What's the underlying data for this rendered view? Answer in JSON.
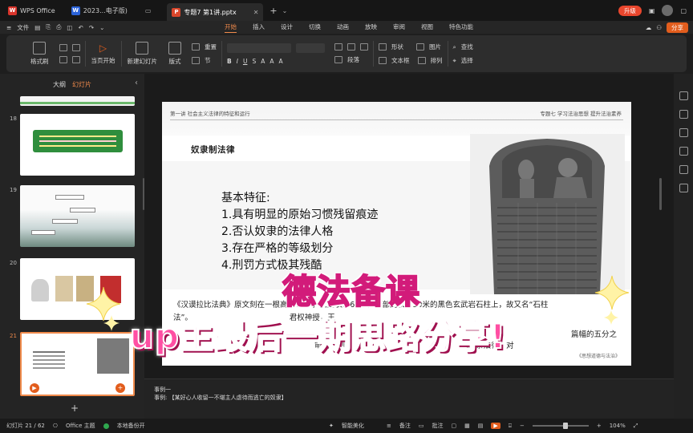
{
  "titlebar": {
    "app_tab": "WPS Office",
    "doc_tab": "2023...电子版)",
    "ppt_tab": "专题7 第1讲.pptx",
    "upgrade": "升级"
  },
  "menubar": {
    "file": "文件",
    "tabs": [
      "开始",
      "插入",
      "设计",
      "切换",
      "动画",
      "放映",
      "审阅",
      "视图",
      "特色功能"
    ],
    "active_tab": "开始",
    "share": "分享"
  },
  "ribbon": {
    "format_painter": "格式刷",
    "play_from_current": "当页开始",
    "new_slide": "新建幻灯片",
    "layout": "版式",
    "section": "节",
    "reset": "重置",
    "paragraph": "段落",
    "shape": "形状",
    "image": "图片",
    "textbox": "文本框",
    "arrange": "排列",
    "find": "查找",
    "select": "选择"
  },
  "sidebar": {
    "tab_outline": "大纲",
    "tab_slides": "幻灯片",
    "slide_numbers": [
      "18",
      "19",
      "20",
      "21"
    ]
  },
  "slide": {
    "header_left": "第一讲  社会主义法律的特征和运行",
    "header_right": "专题七  学习法治思想  提升法治素养",
    "title": "奴隶制法律",
    "features_heading": "基本特征:",
    "features": [
      "1.具有明显的原始习惯残留痕迹",
      "2.否认奴隶的法律人格",
      "3.存在严格的等级划分",
      "4.刑罚方式极其残酷"
    ],
    "para_line1": "《汉谟拉比法典》原文刻在一根高2.25米，上周长1.65米，底部周长1.90米的黑色玄武岩石柱上，故又名“石柱",
    "para_line2": "法”。                                        君权神授，王",
    "para_line3": "篇幅的五分之",
    "para_line4": "审判等制                                                  82条法律，对",
    "footer": "《思想道德与法治》"
  },
  "overlay": {
    "line1": "德法备课",
    "line2": "up主最后一期思路分享!"
  },
  "notes": {
    "line1": "事例一",
    "line2": "事例: 【某好心人收留一不堪主人虐待而逃亡的奴隶】"
  },
  "status": {
    "slide_pos": "幻灯片 21 / 62",
    "theme": "Office 主题",
    "backup": "本地备份开",
    "beautify": "智能美化",
    "notes_btn": "备注",
    "comment_btn": "批注",
    "zoom": "104%"
  },
  "colors": {
    "accent": "#f08a4b",
    "overlay_yellow": "#ffe61b",
    "overlay_pink": "#ff4fa3"
  }
}
